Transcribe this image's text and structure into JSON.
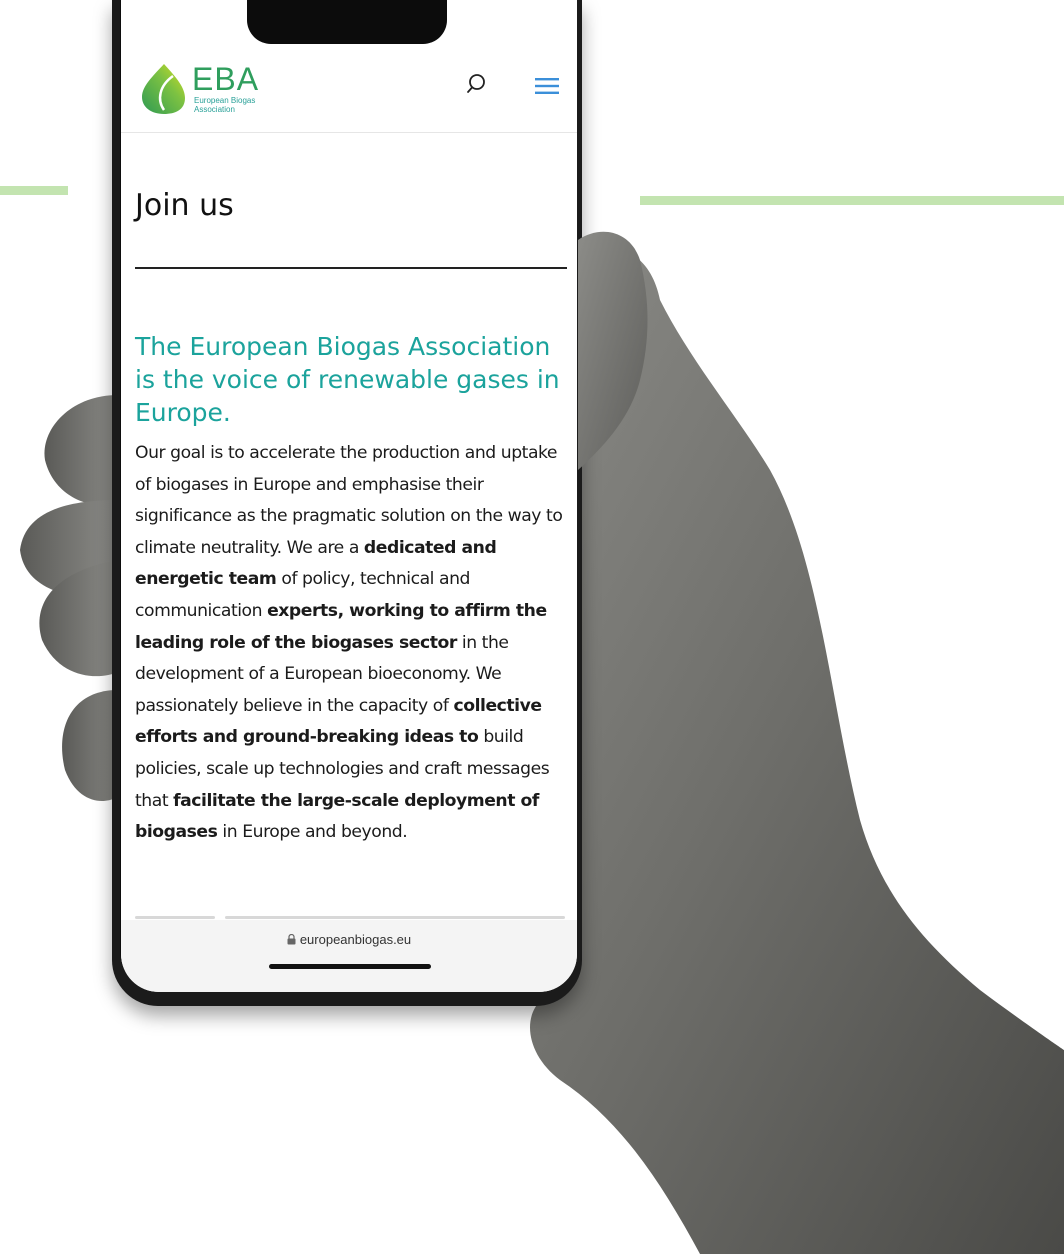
{
  "site": {
    "logo_text": "EBA",
    "logo_subtitle_line1": "European Biogas",
    "logo_subtitle_line2": "Association"
  },
  "header": {
    "search_icon": "search-icon",
    "menu_icon": "hamburger-menu-icon"
  },
  "page": {
    "title": "Join us",
    "headline": "The European Biogas Association is the voice of renewable gases in Europe.",
    "body": {
      "p1": "Our goal is to accelerate the production and uptake of biogases in Europe and emphasise their significance as the pragmatic solution on the way to climate neutrality. We are a ",
      "b1": "dedicated and energetic team",
      "p2": " of policy, technical and communication ",
      "b2": "experts, working to affirm the leading role of the biogases sector",
      "p3": " in the development of a European bioeconomy. We passionately believe in the capacity of ",
      "b3": "collective efforts and ground-breaking ideas to",
      "p4": " build policies, scale up technologies and craft messages that ",
      "b4": "facilitate the large-scale deployment of biogases",
      "p5": " in Europe and beyond."
    }
  },
  "browser": {
    "url": "europeanbiogas.eu",
    "lock_icon": "lock-icon"
  },
  "colors": {
    "accent_teal": "#1ba39c",
    "logo_green": "#2f9e5d",
    "menu_blue": "#3b8fd9",
    "deco_line_green": "#c3e4b0"
  }
}
